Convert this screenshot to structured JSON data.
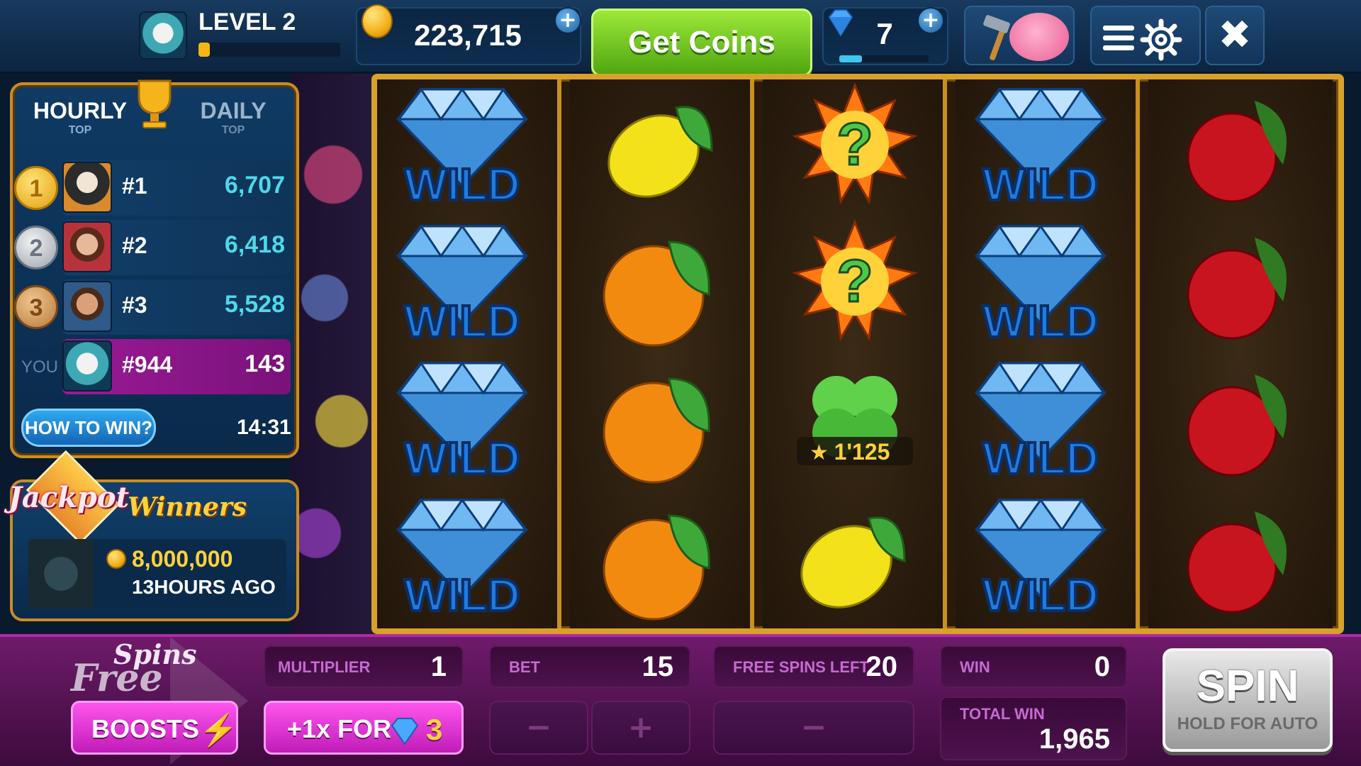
{
  "topbar": {
    "level_label": "LEVEL 2",
    "level_progress": 0.08,
    "coins": "223,715",
    "get_coins_label": "Get Coins",
    "gems": "7",
    "gems_progress": 0.25
  },
  "leaderboard": {
    "tab_hourly": "HOURLY",
    "tab_hourly_sub": "TOP",
    "tab_daily": "DAILY",
    "tab_daily_sub": "TOP",
    "rows": [
      {
        "medal": "1",
        "rank": "#1",
        "score": "6,707"
      },
      {
        "medal": "2",
        "rank": "#2",
        "score": "6,418"
      },
      {
        "medal": "3",
        "rank": "#3",
        "score": "5,528"
      }
    ],
    "you_label": "YOU",
    "you_rank": "#944",
    "you_score": "143",
    "how_to_win": "HOW TO WIN?",
    "timer": "14:31"
  },
  "jackpot": {
    "title_left": "Jackpot",
    "title_right": "Winners",
    "amount": "8,000,000",
    "time_ago": "13HOURS AGO"
  },
  "reels": {
    "wild_label": "WILD",
    "clover_value": "1'125",
    "columns": [
      [
        "wild",
        "wild",
        "wild",
        "wild"
      ],
      [
        "lemon",
        "orange",
        "orange",
        "orange"
      ],
      [
        "mystery",
        "mystery",
        "clover",
        "lemon"
      ],
      [
        "wild",
        "wild",
        "wild",
        "wild"
      ],
      [
        "cherry",
        "cherry",
        "cherry",
        "cherry"
      ]
    ]
  },
  "bottombar": {
    "free_spins_title_1": "Spins",
    "free_spins_title_2": "Free",
    "boosts_label": "BOOSTS",
    "plus_label": "+1x FOR",
    "plus_cost": "3",
    "multiplier_label": "MULTIPLIER",
    "multiplier": "1",
    "bet_label": "BET",
    "bet": "15",
    "free_spins_left_label": "FREE SPINS LEFT",
    "free_spins_left": "20",
    "win_label": "WIN",
    "win": "0",
    "total_win_label": "TOTAL WIN",
    "total_win": "1,965",
    "spin_label": "SPIN",
    "hold_label": "HOLD FOR AUTO",
    "minus": "−",
    "plus": "+"
  }
}
